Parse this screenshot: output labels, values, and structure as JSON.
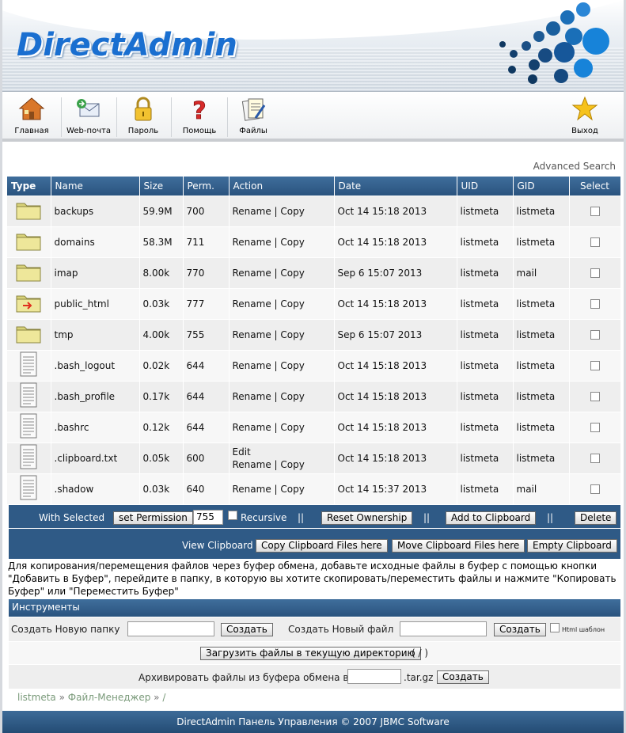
{
  "header": {
    "logo_text": "DirectAdmin"
  },
  "toolbar": {
    "home": "Главная",
    "webmail": "Web-почта",
    "password": "Пароль",
    "help": "Помощь",
    "files": "Файлы",
    "logout": "Выход"
  },
  "advanced_search": "Advanced Search",
  "table": {
    "headers": [
      "Type",
      "Name",
      "Size",
      "Perm.",
      "Action",
      "Date",
      "UID",
      "GID",
      "Select"
    ],
    "rows": [
      {
        "type": "folder",
        "name": "backups",
        "size": "59.9M",
        "perm": "700",
        "action_rename": "Rename",
        "action_copy": "Copy",
        "date": "Oct 14 15:18 2013",
        "uid": "listmeta",
        "gid": "listmeta"
      },
      {
        "type": "folder",
        "name": "domains",
        "size": "58.3M",
        "perm": "711",
        "action_rename": "Rename",
        "action_copy": "Copy",
        "date": "Oct 14 15:18 2013",
        "uid": "listmeta",
        "gid": "listmeta"
      },
      {
        "type": "folder",
        "name": "imap",
        "size": "8.00k",
        "perm": "770",
        "action_rename": "Rename",
        "action_copy": "Copy",
        "date": "Sep 6 15:07 2013",
        "uid": "listmeta",
        "gid": "mail"
      },
      {
        "type": "folder-link",
        "name": "public_html",
        "size": "0.03k",
        "perm": "777",
        "action_rename": "Rename",
        "action_copy": "Copy",
        "date": "Oct 14 15:18 2013",
        "uid": "listmeta",
        "gid": "listmeta"
      },
      {
        "type": "folder",
        "name": "tmp",
        "size": "4.00k",
        "perm": "755",
        "action_rename": "Rename",
        "action_copy": "Copy",
        "date": "Sep 6 15:07 2013",
        "uid": "listmeta",
        "gid": "listmeta"
      },
      {
        "type": "file",
        "name": ".bash_logout",
        "size": "0.02k",
        "perm": "644",
        "action_rename": "Rename",
        "action_copy": "Copy",
        "date": "Oct 14 15:18 2013",
        "uid": "listmeta",
        "gid": "listmeta"
      },
      {
        "type": "file",
        "name": ".bash_profile",
        "size": "0.17k",
        "perm": "644",
        "action_rename": "Rename",
        "action_copy": "Copy",
        "date": "Oct 14 15:18 2013",
        "uid": "listmeta",
        "gid": "listmeta"
      },
      {
        "type": "file",
        "name": ".bashrc",
        "size": "0.12k",
        "perm": "644",
        "action_rename": "Rename",
        "action_copy": "Copy",
        "date": "Oct 14 15:18 2013",
        "uid": "listmeta",
        "gid": "listmeta"
      },
      {
        "type": "file",
        "name": ".clipboard.txt",
        "size": "0.05k",
        "perm": "600",
        "action_edit": "Edit",
        "action_rename": "Rename",
        "action_copy": "Copy",
        "date": "Oct 14 15:18 2013",
        "uid": "listmeta",
        "gid": "listmeta"
      },
      {
        "type": "file",
        "name": ".shadow",
        "size": "0.03k",
        "perm": "640",
        "action_rename": "Rename",
        "action_copy": "Copy",
        "date": "Oct 14 15:37 2013",
        "uid": "listmeta",
        "gid": "mail"
      }
    ]
  },
  "action_bar": {
    "with_selected": "With Selected",
    "set_permission": "set Permission",
    "perm_value": "755",
    "recursive": "Recursive",
    "divider": "||",
    "reset_ownership": "Reset Ownership",
    "add_to_clipboard": "Add to Clipboard",
    "delete": "Delete",
    "view_clipboard": "View Clipboard",
    "copy_clipboard": "Copy Clipboard Files here",
    "move_clipboard": "Move Clipboard Files here",
    "empty_clipboard": "Empty Clipboard"
  },
  "help_text": "Для копирования/перемещения файлов через буфер обмена, добавьте исходные файлы в буфер с помощью кнопки \"Добавить в Буфер\", перейдите в папку, в которую вы хотите скопировать/переместить файлы и нажмите \"Копировать Буфер\" или \"Переместить Буфер\"",
  "tools": {
    "title": "Инструменты",
    "create_folder_label": "Создать Новую папку",
    "create_folder_btn": "Создать",
    "create_file_label": "Создать Новый файл",
    "create_file_btn": "Создать",
    "html_template": "Html шаблон",
    "upload_btn": "Загрузить файлы в текущую директорию",
    "upload_path": "( / )",
    "archive_label": "Архивировать файлы из буфера обмена в //",
    "archive_ext": ".tar.gz",
    "archive_btn": "Создать"
  },
  "breadcrumb": {
    "user": "listmeta",
    "sep": "»",
    "manager": "Файл-Менеджер",
    "path": "/"
  },
  "footer": "DirectAdmin Панель Управления © 2007 JBMC Software"
}
